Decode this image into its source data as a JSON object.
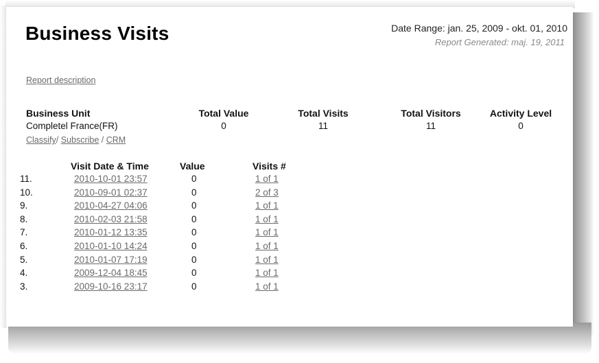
{
  "report": {
    "title": "Business Visits",
    "date_range": "Date Range: jan. 25, 2009 - okt. 01, 2010",
    "generated": "Report Generated: maj. 19, 2011",
    "description_link": "Report description"
  },
  "summary": {
    "headers": {
      "business_unit": "Business Unit",
      "total_value": "Total Value",
      "total_visits": "Total Visits",
      "total_visitors": "Total Visitors",
      "activity_level": "Activity Level"
    },
    "values": {
      "business_unit": "Completel France(FR)",
      "total_value": "0",
      "total_visits": "11",
      "total_visitors": "11",
      "activity_level": "0"
    },
    "actions": {
      "classify": "Classify",
      "sep1": "/ ",
      "subscribe": "Subscribe",
      "sep2": " / ",
      "crm": "CRM"
    }
  },
  "visits": {
    "headers": {
      "date_time": "Visit Date & Time",
      "value": "Value",
      "visits_no": "Visits #"
    },
    "rows": [
      {
        "index": "11.",
        "datetime": "2010-10-01 23:57",
        "value": "0",
        "visits": "1 of 1"
      },
      {
        "index": "10.",
        "datetime": "2010-09-01 02:37",
        "value": "0",
        "visits": "2 of 3"
      },
      {
        "index": "9.",
        "datetime": "2010-04-27 04:06",
        "value": "0",
        "visits": "1 of 1"
      },
      {
        "index": "8.",
        "datetime": "2010-02-03 21:58",
        "value": "0",
        "visits": "1 of 1"
      },
      {
        "index": "7.",
        "datetime": "2010-01-12 13:35",
        "value": "0",
        "visits": "1 of 1"
      },
      {
        "index": "6.",
        "datetime": "2010-01-10 14:24",
        "value": "0",
        "visits": "1 of 1"
      },
      {
        "index": "5.",
        "datetime": "2010-01-07 17:19",
        "value": "0",
        "visits": "1 of 1"
      },
      {
        "index": "4.",
        "datetime": "2009-12-04 18:45",
        "value": "0",
        "visits": "1 of 1"
      },
      {
        "index": "3.",
        "datetime": "2009-10-16 23:17",
        "value": "0",
        "visits": "1 of 1"
      }
    ]
  }
}
